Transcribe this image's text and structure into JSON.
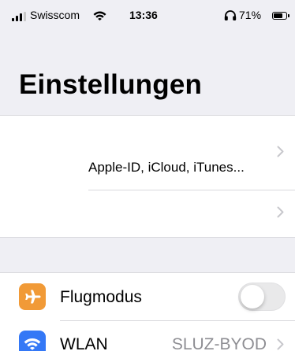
{
  "status_bar": {
    "carrier": "Swisscom",
    "time": "13:36",
    "battery_percent": "71%",
    "battery_level": 0.71,
    "icons": [
      "signal-bars-icon",
      "wifi-icon",
      "headphones-icon",
      "battery-icon"
    ]
  },
  "header": {
    "title": "Einstellungen"
  },
  "account": {
    "subtitle": "Apple-ID, iCloud, iTunes...",
    "icons": [
      "chevron-right-icon"
    ]
  },
  "settings": [
    {
      "label": "Flugmodus",
      "icon": "airplane-icon",
      "icon_color": "#f19a37",
      "control": "toggle",
      "toggle_on": false
    },
    {
      "label": "WLAN",
      "icon": "wifi-icon",
      "icon_color": "#3478f6",
      "value": "SLUZ-BYOD"
    }
  ],
  "colors": {
    "background": "#efeff4",
    "secondary_text": "#8e8e93",
    "chevron": "#c7c7cc"
  }
}
